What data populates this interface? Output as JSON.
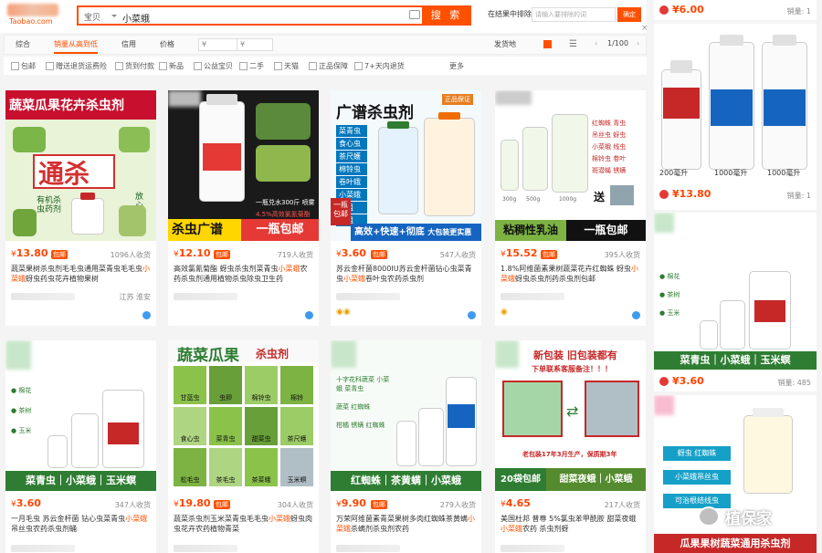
{
  "header": {
    "logo_url": "Taobao.com",
    "category": "宝贝",
    "query": "小菜蛾",
    "search_button": "搜 索",
    "result_search_label": "在结果中排除",
    "result_search_placeholder": "请输入要排除的词",
    "confirm": "确定"
  },
  "sort": {
    "items": [
      "综合",
      "销量从高到低",
      "信用",
      "价格"
    ],
    "price_from": "¥",
    "price_to": "¥",
    "ship_from": "发货地",
    "page": "1/100"
  },
  "filters": [
    "包邮",
    "赠送退货运费险",
    "货到付款",
    "新品",
    "公益宝贝",
    "二手",
    "天猫",
    "正品保障",
    "7+天内退货"
  ],
  "more": "更多",
  "products": [
    {
      "price": "13.80",
      "baoyou": "包邮",
      "sales": "1096人收货",
      "title_a": "蔬菜果树杀虫剂毛毛虫通用菜青虫毛毛虫",
      "title_hl": "小菜蛾",
      "title_b": "蚜虫药虫花卉植物果树",
      "loc": "江苏 淮安",
      "img_headline": "蔬菜瓜果花卉杀虫剂",
      "img_big": "通杀",
      "img_sub": "有机杀虫药剂",
      "img_side": "放心用专业"
    },
    {
      "price": "12.10",
      "baoyou": "包邮",
      "sales": "719人收货",
      "title_a": "高效氯氰菊酯 蚜虫杀虫剂菜青虫",
      "title_hl": "小菜蛾",
      "title_b": "农药杀虫剂通用植物杀虫除虫卫生药",
      "img_banner_a": "杀虫广谱",
      "img_banner_b": "一瓶包邮",
      "img_note": "一瓶兑水300斤 喷雾",
      "img_pct": "4.5%高效氯氰菊酯"
    },
    {
      "price": "3.60",
      "baoyou": "包邮",
      "sales": "547人收货",
      "title_a": "苏云金杆菌8000IU苏云金杆菌钻心虫菜青虫",
      "title_hl": "小菜蛾",
      "title_b": "卷叶虫农药杀虫剂",
      "img_headline": "广谱杀虫剂",
      "img_tag": "正品保证",
      "img_pests": [
        "菜青虫",
        "食心虫",
        "茶尺蠖",
        "棉铃虫",
        "卷叶蛾",
        "小菜蛾",
        "韭蛆",
        "地蛆"
      ],
      "img_bottom": "高效+快速+彻底",
      "img_bottom2": "大包装更实惠",
      "img_left": "一瓶包邮"
    },
    {
      "price": "15.52",
      "baoyou": "包邮",
      "sales": "395人收货",
      "title_a": "1.8%阿维菌素果树蔬菜花卉红蜘蛛 蚜虫",
      "title_hl": "小菜蛾",
      "title_b": "蚜虫杀虫剂药杀虫剂包邮",
      "img_banner_a": "粘稠性乳油",
      "img_banner_b": "一瓶包邮",
      "img_send": "送",
      "img_list": [
        "红蜘蛛 青虫",
        "吊丝虫 蚜虫",
        "小菜蛾 线虫",
        "棉铃虫 卷叶",
        "斑潜蝇 锈螨"
      ],
      "sizes": [
        "300g",
        "500g",
        "1000g"
      ]
    },
    {
      "price": "3.60",
      "baoyou": "",
      "sales": "347人收货",
      "title_a": "一月毛虫 苏云金杆菌 钻心虫菜青虫",
      "title_hl": "小菜蛾",
      "title_b": "吊丝虫农药杀虫剂蛹",
      "img_banner": "菜青虫｜小菜蛾｜玉米螟"
    },
    {
      "price": "19.80",
      "baoyou": "包邮",
      "sales": "304人收货",
      "title_a": "蔬菜杀虫剂玉米菜青虫毛毛虫",
      "title_hl": "小菜蛾",
      "title_b": "蚜虫肉虫花卉农药植物青菜",
      "img_headline": "蔬菜瓜果",
      "img_headline2": "杀虫剂",
      "img_grid": [
        "甘蓝虫",
        "虫卵",
        "棉铃虫",
        "棉铃",
        "食心虫",
        "菜青虫",
        "甜菜虫",
        "茶尺蠖",
        "松毛虫",
        "茶毛虫",
        "茶菜蛾",
        "玉米螟"
      ]
    },
    {
      "price": "9.90",
      "baoyou": "包邮",
      "sales": "279人收货",
      "title_a": "万荣阿维菌素青菜果树多肉红蜘蛛茶黄螨",
      "title_hl": "小菜蛾",
      "title_b": "杀螨剂杀虫剂农药",
      "img_banner": "红蜘蛛｜茶黄螨｜小菜蛾",
      "img_items": [
        "十字花科蔬菜 小菜蛾 菜青虫",
        "蔬菜 红蜘蛛",
        "柑橘 锈螨 红蜘蛛"
      ]
    },
    {
      "price": "4.65",
      "baoyou": "",
      "sales": "217人收货",
      "title_a": "美国杜邦 普尊 5%氯虫苯甲酰胺 甜菜夜蛾",
      "title_hl": "小菜蛾",
      "title_b": "农药 杀虫剂蚜",
      "img_top": "新包装 旧包装都有",
      "img_top2": "下单联系客服备注！！！",
      "img_note": "老包装17年3月生产，保质期3年",
      "img_banner_a": "20袋包邮",
      "img_banner_b": "甜菜夜蛾｜小菜蛾"
    }
  ],
  "side": [
    {
      "price": "6.00",
      "sales": "销量: 1"
    },
    {
      "price": "13.80",
      "sales": "销量: 1",
      "sizes": [
        "200毫升",
        "1000毫升",
        "1000毫升"
      ]
    },
    {
      "price": "3.60",
      "sales": "销量: 485",
      "banner": "菜青虫｜小菜蛾｜玉米螟"
    },
    {
      "tags": [
        "蚜虫 红蜘蛛",
        "小菜蛾吊丝虫",
        "可治根结线虫"
      ],
      "banner": "瓜果果树蔬菜通用杀虫剂"
    }
  ],
  "watermark": "植保家"
}
